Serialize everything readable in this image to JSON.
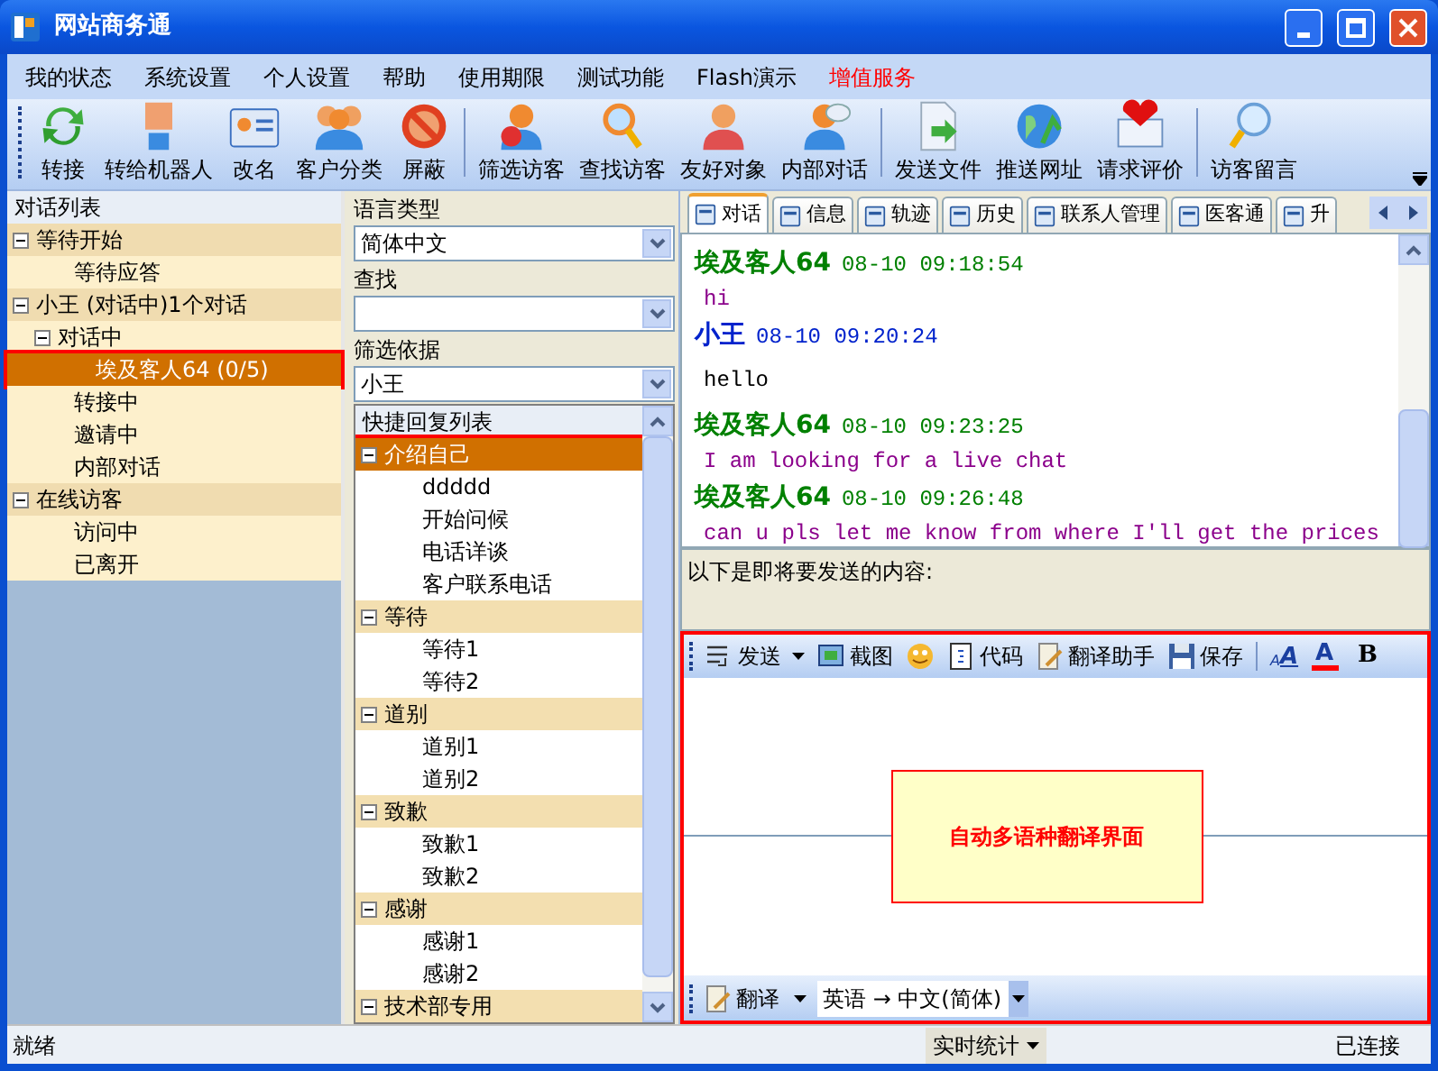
{
  "window": {
    "title": "网站商务通"
  },
  "menu": [
    {
      "label": "我的状态",
      "emphasis": false
    },
    {
      "label": "系统设置",
      "emphasis": false
    },
    {
      "label": "个人设置",
      "emphasis": false
    },
    {
      "label": "帮助",
      "emphasis": false
    },
    {
      "label": "使用期限",
      "emphasis": false
    },
    {
      "label": "测试功能",
      "emphasis": false
    },
    {
      "label": "Flash演示",
      "emphasis": false
    },
    {
      "label": "增值服务",
      "emphasis": true
    }
  ],
  "toolbar": [
    {
      "buttons": [
        "转接",
        "转给机器人",
        "改名",
        "客户分类",
        "屏蔽"
      ]
    },
    {
      "buttons": [
        "筛选访客",
        "查找访客",
        "友好对象",
        "内部对话"
      ]
    },
    {
      "buttons": [
        "发送文件",
        "推送网址",
        "请求评价"
      ]
    },
    {
      "buttons": [
        "访客留言"
      ]
    }
  ],
  "conversation_list": {
    "title": "对话列表",
    "nodes": [
      {
        "label": "等待开始",
        "expanded": true,
        "selected": false,
        "children": [
          {
            "label": "等待应答",
            "selected": false
          }
        ]
      },
      {
        "label": "小王 (对话中)1个对话",
        "expanded": true,
        "selected": false,
        "children": [
          {
            "label": "对话中",
            "expanded": true,
            "selected": false,
            "children": [
              {
                "label": "埃及客人64 (0/5)",
                "selected": true
              }
            ]
          },
          {
            "label": "转接中",
            "selected": false
          },
          {
            "label": "邀请中",
            "selected": false
          },
          {
            "label": "内部对话",
            "selected": false
          }
        ]
      },
      {
        "label": "在线访客",
        "expanded": true,
        "selected": false,
        "children": [
          {
            "label": "访问中",
            "selected": false
          },
          {
            "label": "已离开",
            "selected": false
          }
        ]
      }
    ]
  },
  "filters": [
    {
      "label": "语言类型",
      "value": "简体中文"
    },
    {
      "label": "查找"
    },
    {
      "label": "筛选依据",
      "value": "小王"
    }
  ],
  "quick_replies": {
    "title": "快捷回复列表",
    "groups": [
      {
        "label": "介绍自己",
        "expanded": true,
        "selected": true,
        "children": [
          {
            "label": "ddddd",
            "selected": false
          },
          {
            "label": "开始问候",
            "selected": false
          },
          {
            "label": "电话详谈",
            "selected": false
          },
          {
            "label": "客户联系电话",
            "selected": false
          }
        ]
      },
      {
        "label": "等待",
        "expanded": true,
        "selected": false,
        "children": [
          {
            "label": "等待1",
            "selected": false
          },
          {
            "label": "等待2",
            "selected": false
          }
        ]
      },
      {
        "label": "道别",
        "expanded": true,
        "selected": false,
        "children": [
          {
            "label": "道别1",
            "selected": false
          },
          {
            "label": "道别2",
            "selected": false
          }
        ]
      },
      {
        "label": "致歉",
        "expanded": true,
        "selected": false,
        "children": [
          {
            "label": "致歉1",
            "selected": false
          },
          {
            "label": "致歉2",
            "selected": false
          }
        ]
      },
      {
        "label": "感谢",
        "expanded": true,
        "selected": false,
        "children": [
          {
            "label": "感谢1",
            "selected": false
          },
          {
            "label": "感谢2",
            "selected": false
          }
        ]
      },
      {
        "label": "技术部专用",
        "expanded": true,
        "selected": false
      }
    ]
  },
  "tabs": [
    {
      "label": "对话",
      "selected": true
    },
    {
      "label": "信息",
      "selected": false
    },
    {
      "label": "轨迹",
      "selected": false
    },
    {
      "label": "历史",
      "selected": false
    },
    {
      "label": "联系人管理",
      "selected": false
    },
    {
      "label": "医客通",
      "selected": false
    },
    {
      "label": "升",
      "selected": false
    }
  ],
  "messages": [
    {
      "kind": "visitor",
      "sender": "埃及客人64",
      "time": "08-10 09:18:54",
      "text": "hi"
    },
    {
      "kind": "agent",
      "sender": "小王",
      "time": "08-10 09:20:24",
      "text": "hello"
    },
    {
      "kind": "visitor",
      "sender": "埃及客人64",
      "time": "08-10 09:23:25",
      "text": "I am looking for a live chat"
    },
    {
      "kind": "visitor",
      "sender": "埃及客人64",
      "time": "08-10 09:26:48",
      "text": "can u pls let me know from where I'll get the prices"
    }
  ],
  "compose_hint": "以下是即将要发送的内容:",
  "editor": {
    "highlighted": true,
    "tools": [
      {
        "kind": "send",
        "label": "发送"
      },
      {
        "kind": "screenshot",
        "label": "截图"
      },
      {
        "kind": "emoji"
      },
      {
        "kind": "code",
        "label": "代码"
      },
      {
        "kind": "translate",
        "label": "翻译助手"
      },
      {
        "kind": "save",
        "label": "保存"
      }
    ],
    "format": [
      {
        "kind": "size",
        "label": "A",
        "label_2": "A"
      },
      {
        "kind": "color",
        "label": "A"
      },
      {
        "kind": "bold",
        "label": "B"
      }
    ],
    "note": "自动多语种翻译界面",
    "translate_bar": {
      "label": "翻译",
      "language_pair": "英语 → 中文(简体)"
    }
  },
  "status_bar": {
    "status": "就绪",
    "stats": "实时统计",
    "connection": "已连接"
  }
}
